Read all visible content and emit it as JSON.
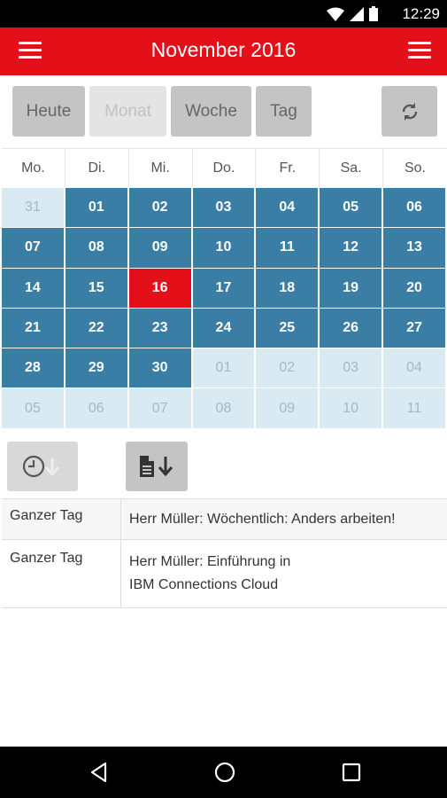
{
  "status": {
    "time": "12:29"
  },
  "header": {
    "title": "November 2016"
  },
  "views": [
    {
      "label": "Heute",
      "enabled": true
    },
    {
      "label": "Monat",
      "enabled": false
    },
    {
      "label": "Woche",
      "enabled": true
    },
    {
      "label": "Tag",
      "enabled": true
    }
  ],
  "calendar": {
    "weekdays": [
      "Mo.",
      "Di.",
      "Mi.",
      "Do.",
      "Fr.",
      "Sa.",
      "So."
    ],
    "weeks": [
      [
        "31",
        "01",
        "02",
        "03",
        "04",
        "05",
        "06"
      ],
      [
        "07",
        "08",
        "09",
        "10",
        "11",
        "12",
        "13"
      ],
      [
        "14",
        "15",
        "16",
        "17",
        "18",
        "19",
        "20"
      ],
      [
        "21",
        "22",
        "23",
        "24",
        "25",
        "26",
        "27"
      ],
      [
        "28",
        "29",
        "30",
        "01",
        "02",
        "03",
        "04"
      ],
      [
        "05",
        "06",
        "07",
        "08",
        "09",
        "10",
        "11"
      ]
    ],
    "today": "16"
  },
  "events": [
    {
      "time": "Ganzer Tag",
      "title": "Herr Müller: Wöchentlich: Anders arbeiten!"
    },
    {
      "time": "Ganzer Tag",
      "title": "Herr Müller: Einführung in",
      "title2": "IBM Connections Cloud"
    }
  ],
  "colors": {
    "accent": "#e3101a",
    "day": "#3a7ea6",
    "otherMonth": "#d9eaf3"
  },
  "icons": {
    "menu_left": "hamburger-menu-icon",
    "menu_right": "hamburger-menu-icon",
    "refresh": "refresh-icon",
    "clock_download": "clock-download-icon",
    "document_download": "document-download-icon",
    "back": "back-triangle-icon",
    "home": "home-circle-icon",
    "recents": "recents-square-icon"
  }
}
